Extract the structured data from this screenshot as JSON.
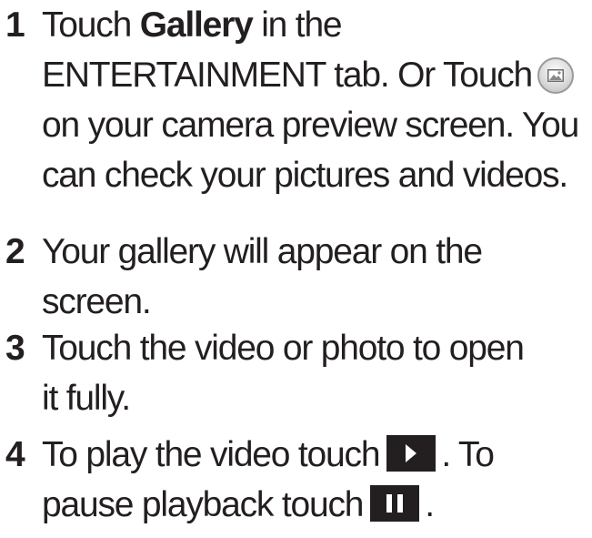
{
  "steps": [
    {
      "number": "1",
      "lines": [
        {
          "before": "Touch ",
          "bold": "Gallery",
          "after": " in the"
        },
        {
          "text": "ENTERTAINMENT tab. Or Touch"
        },
        {
          "text": "on your camera preview screen. You"
        },
        {
          "text": "can check your pictures and videos."
        }
      ],
      "icon": "gallery-icon"
    },
    {
      "number": "2",
      "lines": [
        {
          "text": "Your gallery will appear on the"
        },
        {
          "text": "screen."
        }
      ]
    },
    {
      "number": "3",
      "lines": [
        {
          "text": "Touch the video or photo to open"
        },
        {
          "text": "it fully."
        }
      ]
    },
    {
      "number": "4",
      "lines": [
        {
          "before": "To play the video touch",
          "after": ". To"
        },
        {
          "before": "pause playback touch",
          "after": "."
        }
      ],
      "icons": [
        "play-icon",
        "pause-icon"
      ]
    }
  ]
}
